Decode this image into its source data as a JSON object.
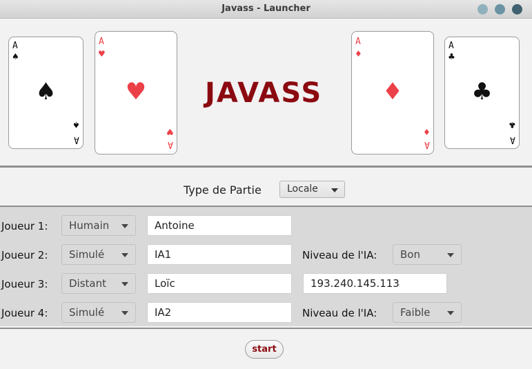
{
  "window": {
    "title": "Javass - Launcher"
  },
  "header": {
    "logo": "JAVASS",
    "cards": [
      {
        "rank": "A",
        "suit": "♠",
        "color": "black"
      },
      {
        "rank": "A",
        "suit": "♥",
        "color": "red"
      },
      {
        "rank": "A",
        "suit": "♦",
        "color": "red"
      },
      {
        "rank": "A",
        "suit": "♣",
        "color": "black"
      }
    ]
  },
  "game_type": {
    "label": "Type de Partie",
    "selected": "Locale"
  },
  "players": [
    {
      "label": "Joueur 1:",
      "type": "Humain",
      "name": "Antoine"
    },
    {
      "label": "Joueur 2:",
      "type": "Simulé",
      "name": "IA1",
      "level_label": "Niveau de l'IA:",
      "level": "Bon"
    },
    {
      "label": "Joueur 3:",
      "type": "Distant",
      "name": "Loïc",
      "address": "193.240.145.113"
    },
    {
      "label": "Joueur 4:",
      "type": "Simulé",
      "name": "IA2",
      "level_label": "Niveau de l'IA:",
      "level": "Faible"
    }
  ],
  "footer": {
    "start_label": "start"
  },
  "colors": {
    "logo": "#8b0a10",
    "red_suit": "#ec4048",
    "separator": "#8e8e8e"
  }
}
